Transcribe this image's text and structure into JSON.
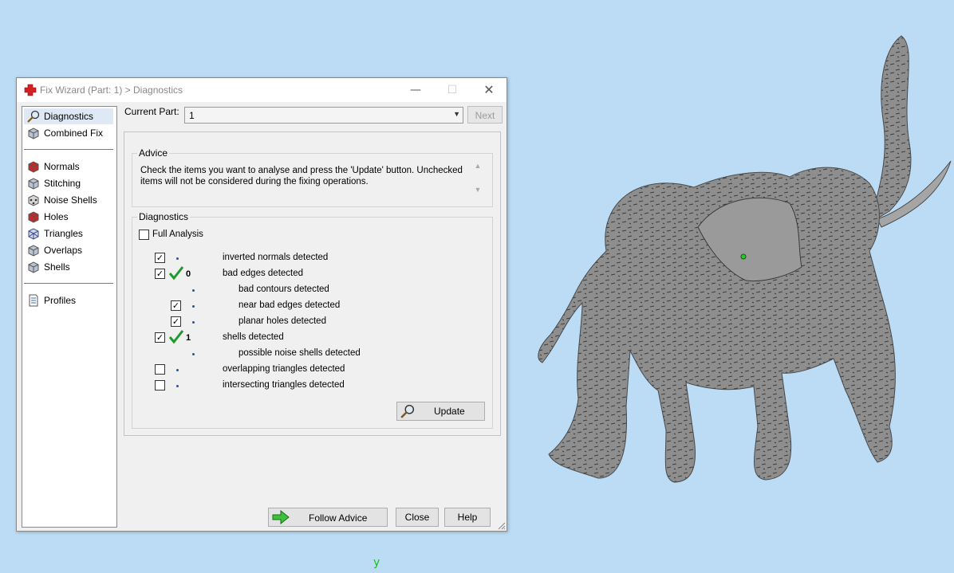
{
  "window": {
    "title": "Fix Wizard (Part: 1) > Diagnostics",
    "minimize_glyph": "—",
    "maximize_glyph": "☐",
    "close_glyph": "✕"
  },
  "sidebar": {
    "items": [
      {
        "label": "Diagnostics",
        "icon": "magnifier-icon",
        "selected": true
      },
      {
        "label": "Combined Fix",
        "icon": "cube-icon"
      },
      {
        "label": "Normals",
        "icon": "red-cube-icon"
      },
      {
        "label": "Stitching",
        "icon": "cube-icon"
      },
      {
        "label": "Noise Shells",
        "icon": "dotted-cube-icon"
      },
      {
        "label": "Holes",
        "icon": "red-cube-icon"
      },
      {
        "label": "Triangles",
        "icon": "wireframe-cube-icon"
      },
      {
        "label": "Overlaps",
        "icon": "cube-icon"
      },
      {
        "label": "Shells",
        "icon": "cube-icon"
      },
      {
        "label": "Profiles",
        "icon": "document-icon"
      }
    ]
  },
  "current_part": {
    "label": "Current Part:",
    "value": "1",
    "next_label": "Next"
  },
  "advice": {
    "title": "Advice",
    "text": "Check the items you want to analyse and press the 'Update' button. Unchecked items will not be considered during the fixing operations."
  },
  "diagnostics": {
    "title": "Diagnostics",
    "full_analysis_label": "Full Analysis",
    "full_analysis_checked": false,
    "rows": [
      {
        "label": "inverted normals detected",
        "checked": true,
        "count": ""
      },
      {
        "label": "bad edges detected",
        "checked": true,
        "count": "0"
      },
      {
        "label": "bad contours detected",
        "checked": null,
        "count": ""
      },
      {
        "label": "near bad edges detected",
        "checked": true,
        "count": ""
      },
      {
        "label": "planar holes detected",
        "checked": true,
        "count": ""
      },
      {
        "label": "shells detected",
        "checked": true,
        "count": "1"
      },
      {
        "label": "possible noise shells detected",
        "checked": null,
        "count": ""
      },
      {
        "label": "overlapping triangles detected",
        "checked": false,
        "count": ""
      },
      {
        "label": "intersecting triangles detected",
        "checked": false,
        "count": ""
      }
    ],
    "update_label": "Update"
  },
  "footer": {
    "follow_advice_label": "Follow Advice",
    "close_label": "Close",
    "help_label": "Help"
  },
  "viewport": {
    "axis_label": "y",
    "background_color": "#bcdcf6",
    "model": "elephant-mesh"
  },
  "check_mark": "✓"
}
